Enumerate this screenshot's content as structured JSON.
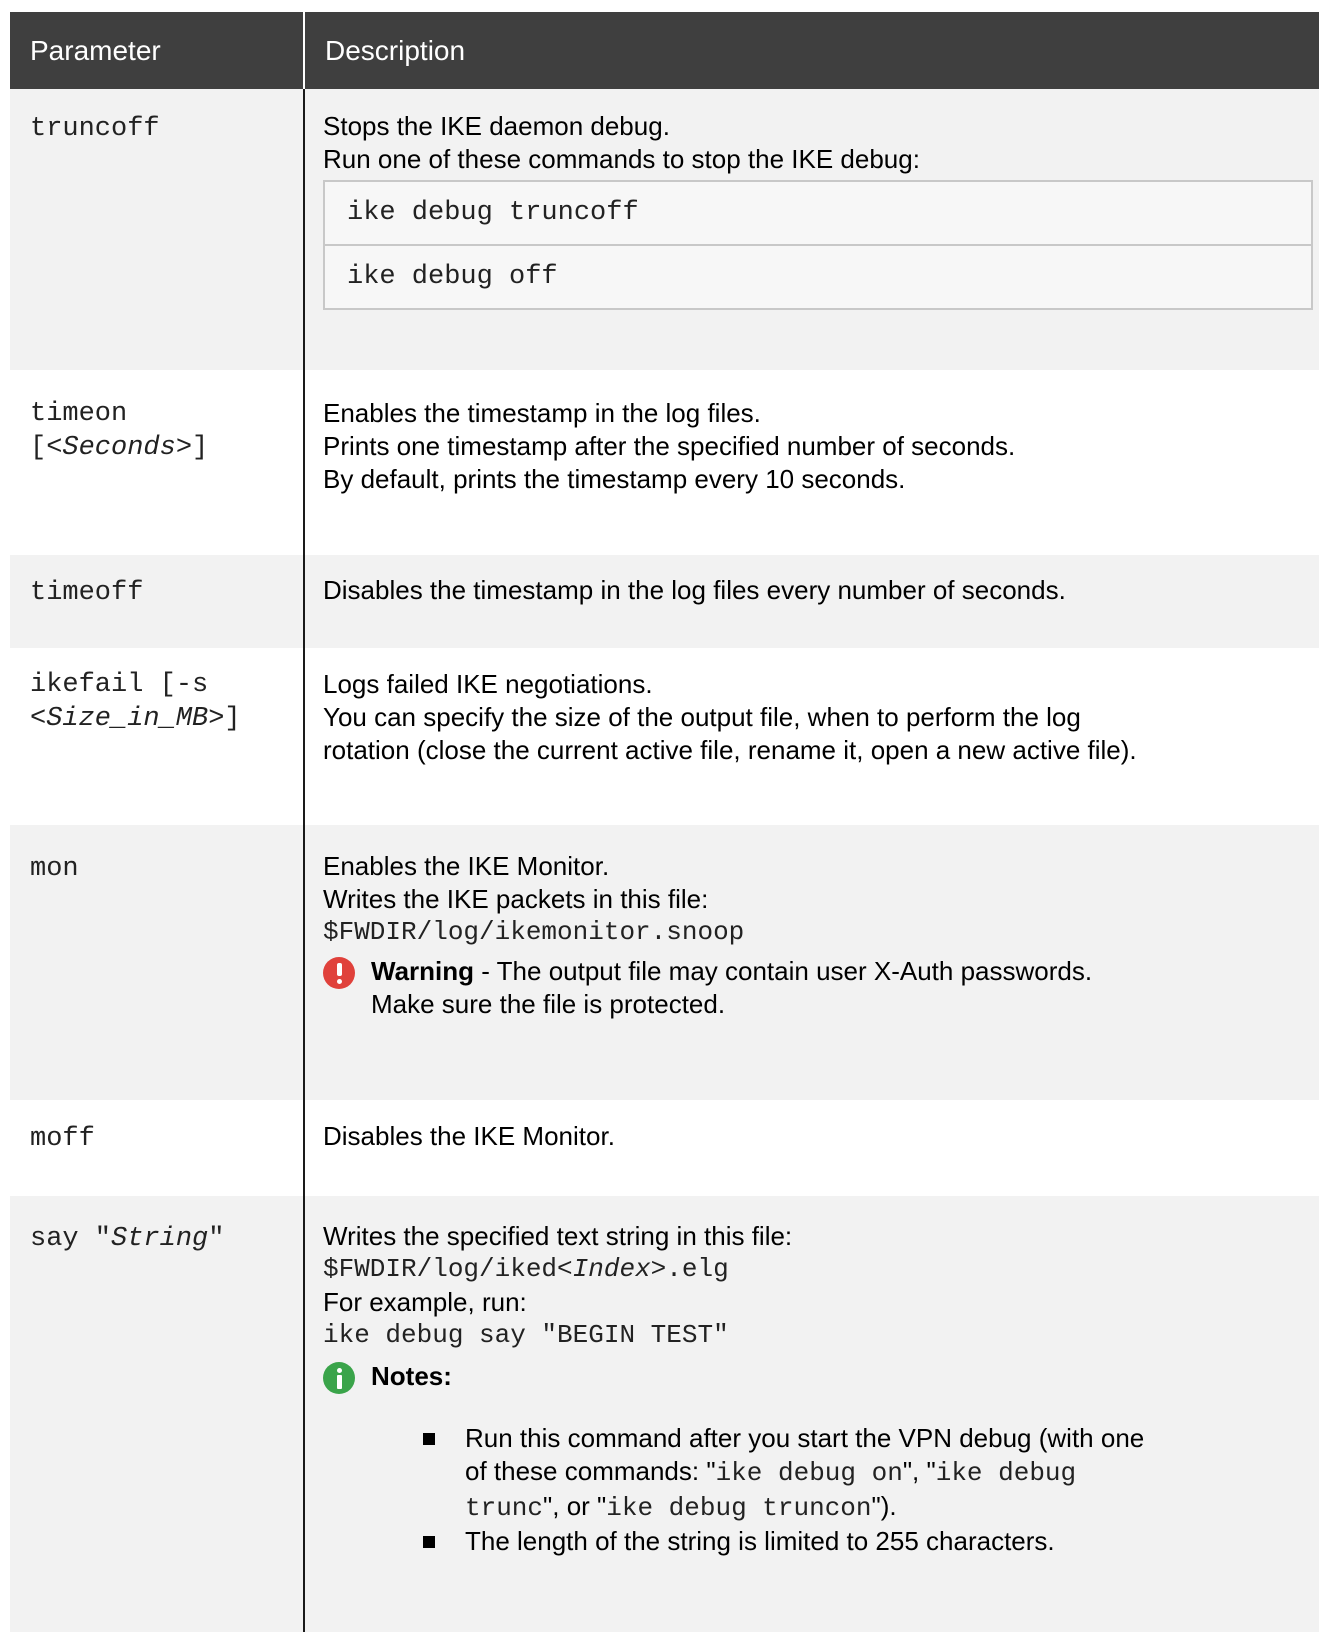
{
  "header": {
    "col1": "Parameter",
    "col2": "Description"
  },
  "rows": {
    "truncoff": {
      "param": "truncoff",
      "desc1": "Stops the IKE daemon debug.",
      "desc2": "Run one of these commands to stop the IKE debug:",
      "cmd1": "ike debug truncoff",
      "cmd2": "ike debug off"
    },
    "timeon": {
      "param_a": "timeon",
      "param_b_pre": "[<",
      "param_b_it": "Seconds",
      "param_b_post": ">]",
      "desc1": "Enables the timestamp in the log files.",
      "desc2": "Prints one timestamp after the specified number of seconds.",
      "desc3": "By default, prints the timestamp every 10 seconds."
    },
    "timeoff": {
      "param": "timeoff",
      "desc1": "Disables the timestamp in the log files every number of seconds."
    },
    "ikefail": {
      "param_a": "ikefail [-s",
      "param_b_pre": "<",
      "param_b_it": "Size_in_MB",
      "param_b_post": ">]",
      "desc1": "Logs failed IKE negotiations.",
      "desc2": "You can specify the size of the output file, when to perform the log",
      "desc3": "rotation (close the current active file, rename it, open a new active file)."
    },
    "mon": {
      "param": "mon",
      "desc1": "Enables the IKE Monitor.",
      "desc2": "Writes the IKE packets in this file:",
      "path": "$FWDIR/log/ikemonitor.snoop",
      "warn_label": "Warning",
      "warn_text1": " - The output file may contain user X-Auth passwords.",
      "warn_text2": "Make sure the file is protected."
    },
    "moff": {
      "param": "moff",
      "desc1": "Disables the IKE Monitor."
    },
    "say": {
      "param_pre": "say \"",
      "param_it": "String",
      "param_post": "\"",
      "desc1": "Writes the specified text string in this file:",
      "path_pre": "$FWDIR/log/iked<",
      "path_it": "Index",
      "path_post": ">.elg",
      "desc2": "For example, run:",
      "example": "ike debug say \"BEGIN TEST\"",
      "notes_label": "Notes:",
      "note1_a": "Run this command after you start the VPN debug (with one",
      "note1_b": "of these commands: \"",
      "note1_c": "ike debug on",
      "note1_d": "\", \"",
      "note1_e": "ike debug",
      "note1_f": "trunc",
      "note1_g": "\", or \"",
      "note1_h": "ike debug truncon",
      "note1_i": "\").",
      "note2": "The length of the string is limited to 255 characters."
    }
  }
}
